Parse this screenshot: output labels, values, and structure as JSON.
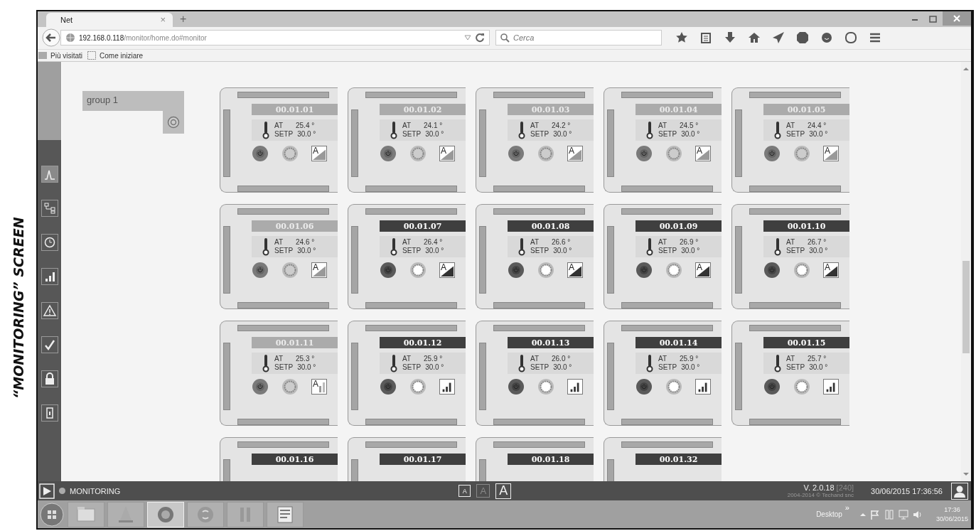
{
  "document_label": "“MONITORING” SCREEN",
  "browser": {
    "tabs": [
      {
        "title": "Net",
        "close": "×"
      }
    ],
    "new_tab": "+",
    "url": {
      "host": "192.168.0.118",
      "path": "/monitor/home.do#monitor"
    },
    "search": {
      "placeholder": "Cerca"
    },
    "bookmarks": [
      {
        "label": "Più visitati",
        "kind": "folder"
      },
      {
        "label": "Come iniziare",
        "kind": "page"
      }
    ]
  },
  "app": {
    "sidebar": {
      "items": [
        {
          "kind": "chart",
          "selected": true
        },
        {
          "kind": "diagram",
          "selected": false
        },
        {
          "kind": "clock",
          "selected": false
        },
        {
          "kind": "bars",
          "selected": false
        },
        {
          "kind": "warning",
          "selected": false
        },
        {
          "kind": "check",
          "selected": false
        },
        {
          "kind": "lock",
          "selected": false
        },
        {
          "kind": "device",
          "selected": false
        }
      ]
    },
    "group": {
      "name": "group 1"
    },
    "devices": [
      {
        "id": "00.01.01",
        "active": false,
        "readings": [
          {
            "label": "AT",
            "value": "25.4 °"
          },
          {
            "label": "SETP",
            "value": "30.0 °"
          }
        ],
        "mode": {
          "kind": "ramp",
          "letter": "A"
        }
      },
      {
        "id": "00.01.02",
        "active": false,
        "readings": [
          {
            "label": "AT",
            "value": "24.1 °"
          },
          {
            "label": "SETP",
            "value": "30.0 °"
          }
        ],
        "mode": {
          "kind": "ramp",
          "letter": "A"
        }
      },
      {
        "id": "00.01.03",
        "active": false,
        "readings": [
          {
            "label": "AT",
            "value": "24.2 °"
          },
          {
            "label": "SETP",
            "value": "30.0 °"
          }
        ],
        "mode": {
          "kind": "ramp",
          "letter": "A"
        }
      },
      {
        "id": "00.01.04",
        "active": false,
        "readings": [
          {
            "label": "AT",
            "value": "24.5 °"
          },
          {
            "label": "SETP",
            "value": "30.0 °"
          }
        ],
        "mode": {
          "kind": "ramp",
          "letter": "A"
        }
      },
      {
        "id": "00.01.05",
        "active": false,
        "readings": [
          {
            "label": "AT",
            "value": "24.4 °"
          },
          {
            "label": "SETP",
            "value": "30.0 °"
          }
        ],
        "mode": {
          "kind": "ramp",
          "letter": "A"
        }
      },
      {
        "id": "00.01.06",
        "active": false,
        "readings": [
          {
            "label": "AT",
            "value": "24.6 °"
          },
          {
            "label": "SETP",
            "value": "30.0 °"
          }
        ],
        "mode": {
          "kind": "ramp",
          "letter": "A"
        }
      },
      {
        "id": "00.01.07",
        "active": true,
        "readings": [
          {
            "label": "AT",
            "value": "26.4 °"
          },
          {
            "label": "SETP",
            "value": "30.0 °"
          }
        ],
        "mode": {
          "kind": "ramp",
          "letter": "A"
        }
      },
      {
        "id": "00.01.08",
        "active": true,
        "readings": [
          {
            "label": "AT",
            "value": "26.6 °"
          },
          {
            "label": "SETP",
            "value": "30.0 °"
          }
        ],
        "mode": {
          "kind": "ramp",
          "letter": "A"
        }
      },
      {
        "id": "00.01.09",
        "active": true,
        "readings": [
          {
            "label": "AT",
            "value": "26.9 °"
          },
          {
            "label": "SETP",
            "value": "30.0 °"
          }
        ],
        "mode": {
          "kind": "ramp",
          "letter": "A"
        }
      },
      {
        "id": "00.01.10",
        "active": true,
        "readings": [
          {
            "label": "AT",
            "value": "26.7 °"
          },
          {
            "label": "SETP",
            "value": "30.0 °"
          }
        ],
        "mode": {
          "kind": "ramp",
          "letter": "A"
        }
      },
      {
        "id": "00.01.11",
        "active": false,
        "readings": [
          {
            "label": "AT",
            "value": "25.3 °"
          },
          {
            "label": "SETP",
            "value": "30.0 °"
          }
        ],
        "mode": {
          "kind": "ramp-bars",
          "letter": "A"
        }
      },
      {
        "id": "00.01.12",
        "active": true,
        "readings": [
          {
            "label": "AT",
            "value": "25.9 °"
          },
          {
            "label": "SETP",
            "value": "30.0 °"
          }
        ],
        "mode": {
          "kind": "bars"
        }
      },
      {
        "id": "00.01.13",
        "active": true,
        "readings": [
          {
            "label": "AT",
            "value": "26.0 °"
          },
          {
            "label": "SETP",
            "value": "30.0 °"
          }
        ],
        "mode": {
          "kind": "bars"
        }
      },
      {
        "id": "00.01.14",
        "active": true,
        "readings": [
          {
            "label": "AT",
            "value": "25.9 °"
          },
          {
            "label": "SETP",
            "value": "30.0 °"
          }
        ],
        "mode": {
          "kind": "bars"
        }
      },
      {
        "id": "00.01.15",
        "active": true,
        "readings": [
          {
            "label": "AT",
            "value": "25.7 °"
          },
          {
            "label": "SETP",
            "value": "30.0 °"
          }
        ],
        "mode": {
          "kind": "bars"
        }
      },
      {
        "id": "00.01.16",
        "active": true
      },
      {
        "id": "00.01.17",
        "active": true
      },
      {
        "id": "00.01.18",
        "active": true
      },
      {
        "id": "00.01.32",
        "active": true
      }
    ],
    "status_bar": {
      "mode": "MONITORING",
      "font_buttons": [
        {
          "label": "A",
          "kind": "small",
          "disabled": false
        },
        {
          "label": "A",
          "kind": "medium",
          "disabled": true
        },
        {
          "label": "A",
          "kind": "large",
          "disabled": false
        }
      ],
      "version": "V. 2.0.18",
      "build": "[240]",
      "copyright": "2004-2014 © Techand snc",
      "datetime": "30/06/2015 17:36:56"
    }
  },
  "taskbar": {
    "apps": [
      {
        "kind": "folder",
        "selected": false
      },
      {
        "kind": "cone",
        "selected": false
      },
      {
        "kind": "browser",
        "selected": true
      },
      {
        "kind": "chat",
        "selected": false
      },
      {
        "kind": "ide",
        "selected": false
      },
      {
        "kind": "document",
        "selected": false
      }
    ],
    "desktop": "Desktop",
    "overflow": "»",
    "time": "17:36",
    "date": "30/06/2015"
  }
}
